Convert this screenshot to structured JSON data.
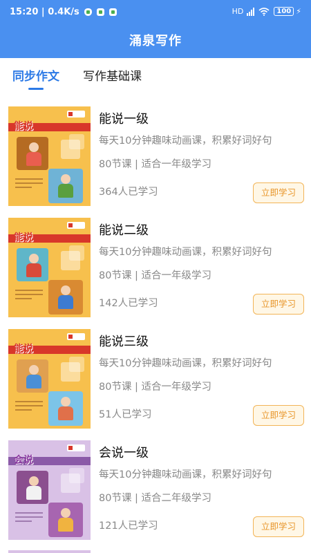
{
  "status_bar": {
    "time": "15:20",
    "speed": "0.4K/s",
    "network": "HD",
    "battery": "100"
  },
  "app_title": "涌泉写作",
  "tabs": [
    {
      "label": "同步作文",
      "active": true
    },
    {
      "label": "写作基础课",
      "active": false
    }
  ],
  "courses": [
    {
      "name": "能说一级",
      "desc": "每天10分钟趣味动画课，积累好词好句",
      "meta": "80节课 | 适合一年级学习",
      "learners": "364人已学习",
      "button": "立即学习",
      "cover_title": "能说",
      "cover_color": "#f7c04d"
    },
    {
      "name": "能说二级",
      "desc": "每天10分钟趣味动画课，积累好词好句",
      "meta": "80节课 | 适合一年级学习",
      "learners": "142人已学习",
      "button": "立即学习",
      "cover_title": "能说",
      "cover_color": "#f7c04d"
    },
    {
      "name": "能说三级",
      "desc": "每天10分钟趣味动画课，积累好词好句",
      "meta": "80节课 | 适合一年级学习",
      "learners": "51人已学习",
      "button": "立即学习",
      "cover_title": "能说",
      "cover_color": "#f7c04d"
    },
    {
      "name": "会说一级",
      "desc": "每天10分钟趣味动画课，积累好词好句",
      "meta": "80节课 | 适合二年级学习",
      "learners": "121人已学习",
      "button": "立即学习",
      "cover_title": "会说",
      "cover_color": "#d9c1e6"
    }
  ],
  "colors": {
    "header": "#4a90f0",
    "tab_active": "#2b79e6",
    "button_text": "#e8962a",
    "button_border": "#f2b456"
  }
}
